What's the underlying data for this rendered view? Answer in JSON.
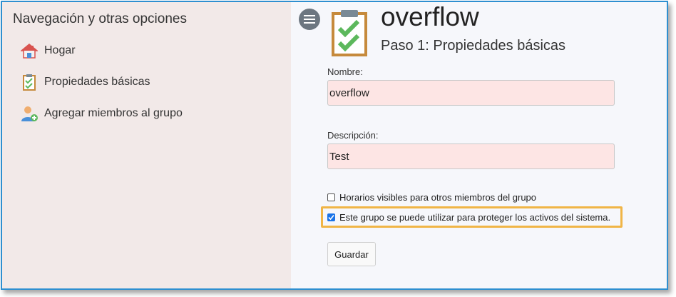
{
  "sidebar": {
    "title": "Navegación y otras opciones",
    "items": [
      {
        "label": "Hogar",
        "icon": "home-icon"
      },
      {
        "label": "Propiedades básicas",
        "icon": "clipboard-check-icon"
      },
      {
        "label": "Agregar miembros al grupo",
        "icon": "add-user-icon"
      }
    ]
  },
  "header": {
    "group_name": "overflow",
    "step_title": "Paso 1: Propiedades básicas"
  },
  "form": {
    "name_label": "Nombre:",
    "name_value": "overflow",
    "description_label": "Descripción:",
    "description_value": "Test",
    "checkbox_schedules": {
      "label": "Horarios visibles para otros miembros del grupo",
      "checked": false
    },
    "checkbox_protect": {
      "label": "Este grupo se puede utilizar para proteger los activos del sistema.",
      "checked": true
    },
    "save_label": "Guardar"
  },
  "colors": {
    "accent_border": "#2e8fd0",
    "highlight": "#f0b546",
    "input_bg": "#fde5e4",
    "sidebar_bg": "#f2e9e8"
  }
}
